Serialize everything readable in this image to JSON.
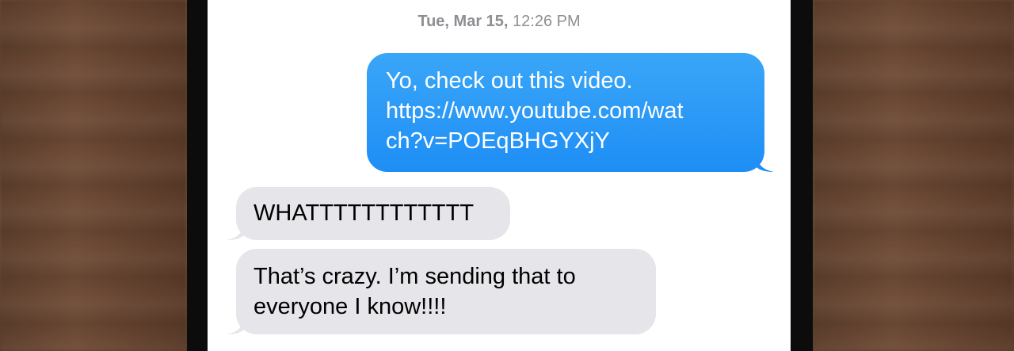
{
  "conversation": {
    "timestamp": {
      "date": "Tue, Mar 15,",
      "time": "12:26 PM"
    },
    "messages": [
      {
        "direction": "outgoing",
        "lines": [
          "Yo, check out this video.",
          "https://www.youtube.com/wat",
          "ch?v=POEqBHGYXjY"
        ]
      },
      {
        "direction": "incoming",
        "lines": [
          "WHATTTTTTTTTTTT"
        ]
      },
      {
        "direction": "incoming",
        "lines": [
          "That’s crazy. I’m sending that to",
          "everyone I know!!!!"
        ]
      }
    ]
  },
  "colors": {
    "outgoing_bubble": "#1e8ef5",
    "incoming_bubble": "#e5e5ea",
    "timestamp_text": "#8e8e93"
  }
}
